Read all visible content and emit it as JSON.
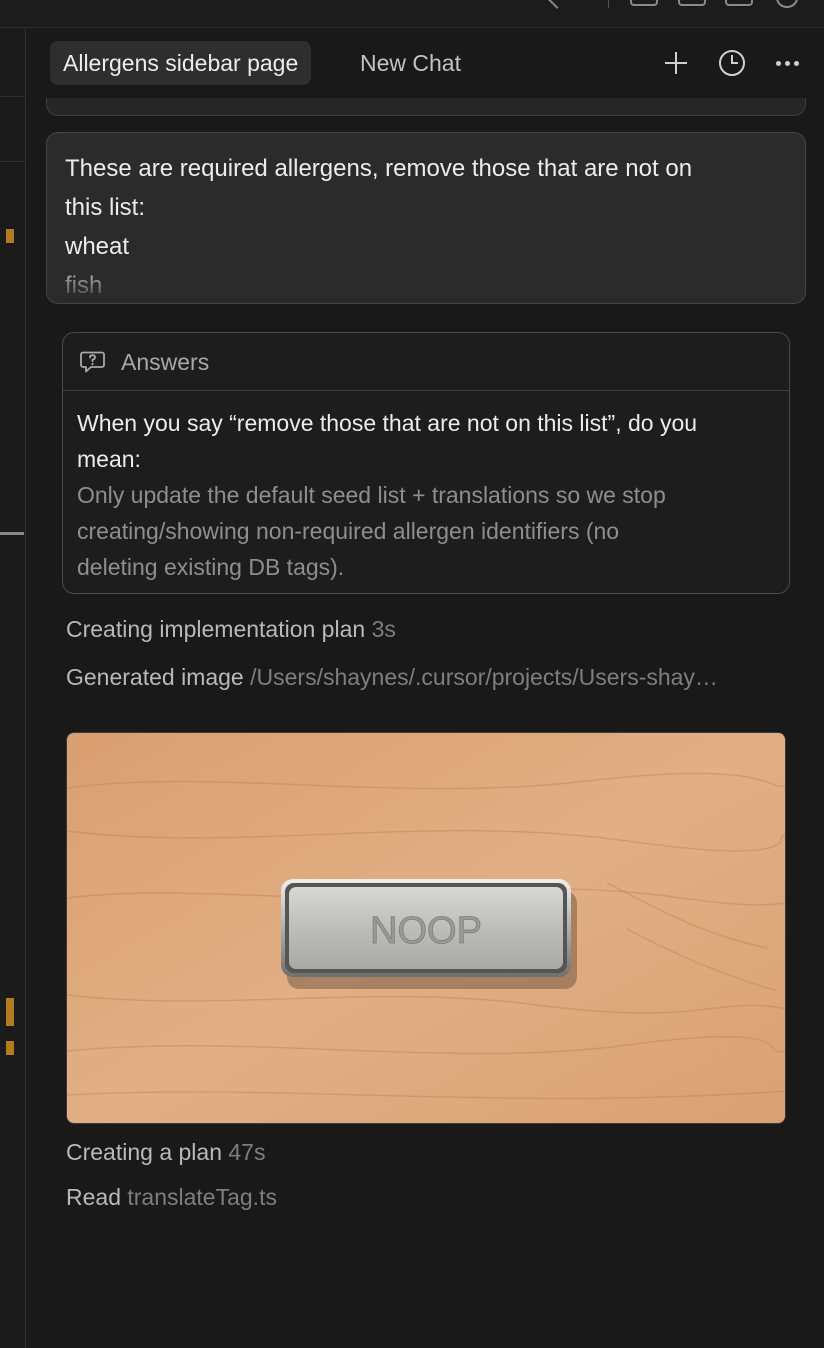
{
  "tabs": {
    "active_label": "Allergens sidebar page",
    "new_chat_label": "New Chat"
  },
  "header_icons": [
    "plus-icon",
    "history-icon",
    "more-icon"
  ],
  "user_message": {
    "lines": [
      "These are required allergens, remove those that are not on",
      "this list:",
      "wheat",
      "fish"
    ]
  },
  "answers": {
    "title": "Answers",
    "icon": "question-bubble-icon",
    "question_lines": [
      "When you say “remove those that are not on this list”, do you",
      "mean:"
    ],
    "answer_lines": [
      "Only update the default seed list + translations so we stop",
      "creating/showing non-required allergen identifiers (no",
      "deleting existing DB tags)."
    ]
  },
  "steps": [
    {
      "label": "Creating implementation plan",
      "value": "3s"
    },
    {
      "label": "Generated image",
      "value": "/Users/shaynes/.cursor/projects/Users-shay…"
    },
    {
      "label": "Creating a plan",
      "value": "47s"
    },
    {
      "label": "Read",
      "value": "translateTag.ts"
    }
  ],
  "generated_image": {
    "plate_text": "NOOP"
  },
  "colors": {
    "background": "#191919",
    "accent_marker": "#b07c1f",
    "wood": "#dca77a"
  }
}
